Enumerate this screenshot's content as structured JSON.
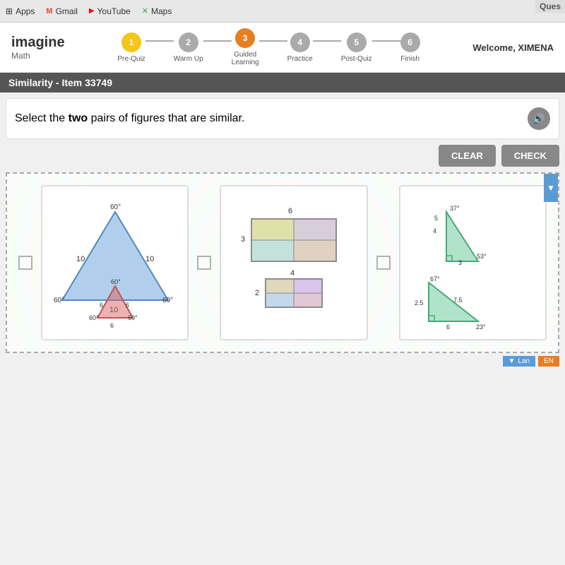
{
  "browser": {
    "tabs": [
      {
        "label": "Apps",
        "icon": "apps-icon"
      },
      {
        "label": "Gmail",
        "icon": "gmail-icon"
      },
      {
        "label": "YouTube",
        "icon": "youtube-icon"
      },
      {
        "label": "Maps",
        "icon": "maps-icon"
      }
    ]
  },
  "header": {
    "logo": "imagine",
    "subject": "Math",
    "welcome": "Welcome, XIMENA"
  },
  "progress": {
    "steps": [
      {
        "number": "1",
        "label": "Pre-Quiz",
        "state": "active"
      },
      {
        "number": "2",
        "label": "Warm Up",
        "state": "inactive"
      },
      {
        "number": "3",
        "label": "Guided\nLearning",
        "state": "current"
      },
      {
        "number": "4",
        "label": "Practice",
        "state": "inactive"
      },
      {
        "number": "5",
        "label": "Post-Quiz",
        "state": "inactive"
      },
      {
        "number": "6",
        "label": "Finish",
        "state": "inactive"
      }
    ]
  },
  "item": {
    "title": "Similarity - Item 33749",
    "ques_label": "Ques"
  },
  "question": {
    "text": "Select the ",
    "bold": "two",
    "text2": " pairs of figures that are similar.",
    "audio_label": "audio"
  },
  "buttons": {
    "clear": "CLEAR",
    "check": "CHECK"
  },
  "figures": {
    "card1": {
      "description": "Two triangles - equilateral"
    },
    "card2": {
      "description": "Two rectangles"
    },
    "card3": {
      "description": "Two right triangles with angle measurements"
    }
  },
  "sidebar": {
    "arrow_label": "▼",
    "lang_label": "Lan"
  }
}
